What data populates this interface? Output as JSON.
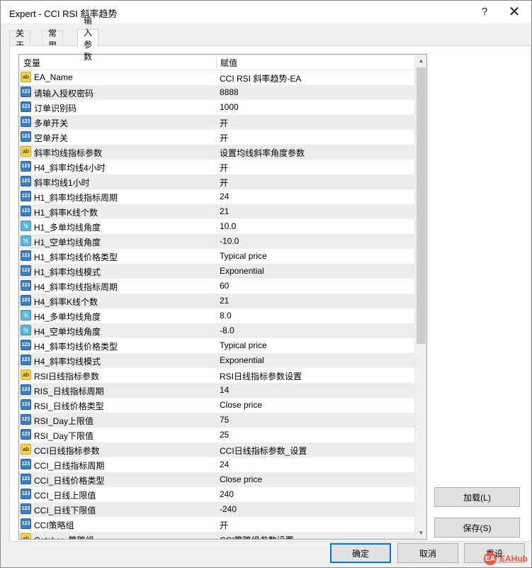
{
  "window": {
    "title": "Expert - CCI RSI 斜率趋势",
    "help_glyph": "?",
    "close_glyph": "✕"
  },
  "tabs": [
    {
      "label": "关于",
      "active": false
    },
    {
      "label": "常用",
      "active": false
    },
    {
      "label": "输入参数",
      "active": true
    }
  ],
  "grid": {
    "col_variable": "变量",
    "col_value": "赋值",
    "rows": [
      {
        "type": "str",
        "icon": "ab",
        "variable": "EA_Name",
        "value": "CCI RSI 斜率趋势-EA"
      },
      {
        "type": "num",
        "icon": "123",
        "variable": "请输入授权密码",
        "value": "8888"
      },
      {
        "type": "num",
        "icon": "123",
        "variable": "订单识别码",
        "value": "1000"
      },
      {
        "type": "num",
        "icon": "123",
        "variable": "多单开关",
        "value": "开"
      },
      {
        "type": "num",
        "icon": "123",
        "variable": "空单开关",
        "value": "开"
      },
      {
        "type": "str",
        "icon": "ab",
        "variable": "斜率均线指标参数",
        "value": "设置均线斜率角度参数"
      },
      {
        "type": "num",
        "icon": "123",
        "variable": "H4_斜率均线4小时",
        "value": "开"
      },
      {
        "type": "num",
        "icon": "123",
        "variable": "斜率均线1小时",
        "value": "开"
      },
      {
        "type": "num",
        "icon": "123",
        "variable": "H1_斜率均线指标周期",
        "value": "24"
      },
      {
        "type": "num",
        "icon": "123",
        "variable": "H1_斜率K线个数",
        "value": "21"
      },
      {
        "type": "dbl",
        "icon": "½",
        "variable": "H1_多单均线角度",
        "value": "10.0"
      },
      {
        "type": "dbl",
        "icon": "½",
        "variable": "H1_空单均线角度",
        "value": "-10.0"
      },
      {
        "type": "num",
        "icon": "123",
        "variable": "H1_斜率均线价格类型",
        "value": "Typical price"
      },
      {
        "type": "num",
        "icon": "123",
        "variable": "H1_斜率均线模式",
        "value": "Exponential"
      },
      {
        "type": "num",
        "icon": "123",
        "variable": "H4_斜率均线指标周期",
        "value": "60"
      },
      {
        "type": "num",
        "icon": "123",
        "variable": "H4_斜率K线个数",
        "value": "21"
      },
      {
        "type": "dbl",
        "icon": "½",
        "variable": "H4_多单均线角度",
        "value": "8.0"
      },
      {
        "type": "dbl",
        "icon": "½",
        "variable": "H4_空单均线角度",
        "value": "-8.0"
      },
      {
        "type": "num",
        "icon": "123",
        "variable": "H4_斜率均线价格类型",
        "value": "Typical price"
      },
      {
        "type": "num",
        "icon": "123",
        "variable": "H4_斜率均线模式",
        "value": "Exponential"
      },
      {
        "type": "str",
        "icon": "ab",
        "variable": "RSI日线指标参数",
        "value": "RSI日线指标参数设置"
      },
      {
        "type": "num",
        "icon": "123",
        "variable": "RIS_日线指标周期",
        "value": "14"
      },
      {
        "type": "num",
        "icon": "123",
        "variable": "RSI_日线价格类型",
        "value": "Close price"
      },
      {
        "type": "num",
        "icon": "123",
        "variable": "RSI_Day上限值",
        "value": "75"
      },
      {
        "type": "num",
        "icon": "123",
        "variable": "RSI_Day下限值",
        "value": "25"
      },
      {
        "type": "str",
        "icon": "ab",
        "variable": "CCI日线指标参数",
        "value": "CCI日线指标参数_设置"
      },
      {
        "type": "num",
        "icon": "123",
        "variable": "CCI_日线指标周期",
        "value": "24"
      },
      {
        "type": "num",
        "icon": "123",
        "variable": "CCI_日线价格类型",
        "value": "Close price"
      },
      {
        "type": "num",
        "icon": "123",
        "variable": "CCI_日线上限值",
        "value": "240"
      },
      {
        "type": "num",
        "icon": "123",
        "variable": "CCI_日线下限值",
        "value": "-240"
      },
      {
        "type": "num",
        "icon": "123",
        "variable": "CCI策略组",
        "value": "开"
      },
      {
        "type": "str",
        "icon": "ab",
        "variable": "Catcher_策略组",
        "value": "CCI策略组参数设置"
      }
    ]
  },
  "buttons": {
    "load": "加载(L)",
    "save": "保存(S)",
    "ok": "确定",
    "cancel": "取消",
    "reset": "重设"
  },
  "watermark": {
    "logo": "EA",
    "text": "EAHub"
  },
  "colors": {
    "accent": "#0078d7",
    "row_alt": "#ececec"
  }
}
